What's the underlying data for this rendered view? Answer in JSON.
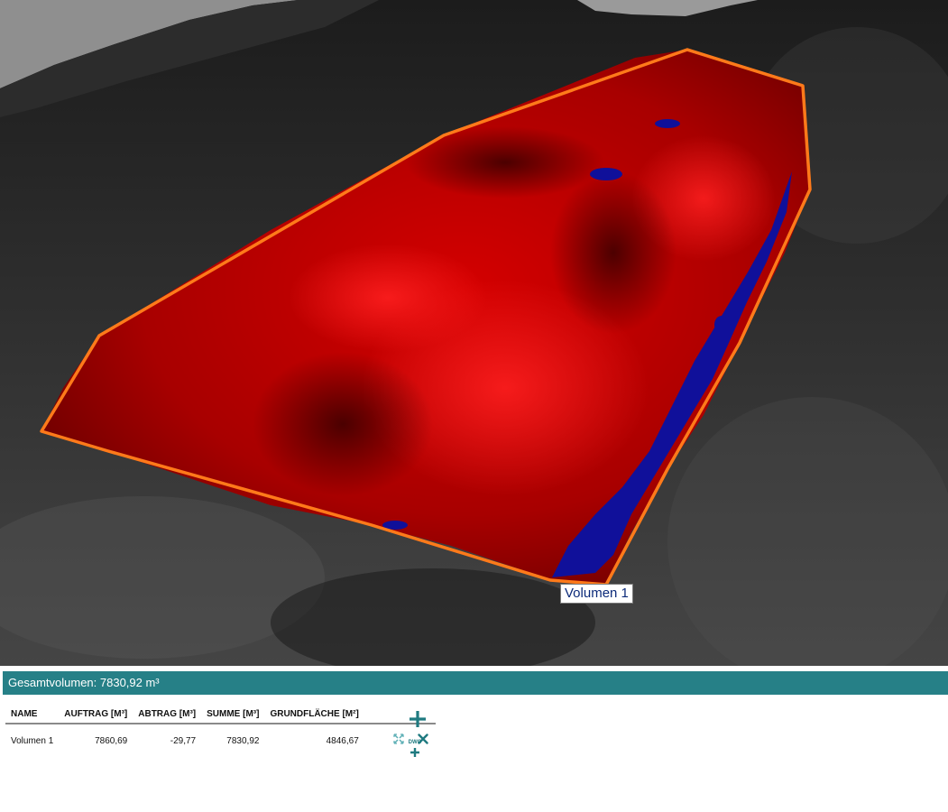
{
  "viewport": {
    "volume_label": "Volumen 1",
    "colors": {
      "boundary": "#ff7a1a",
      "fill_area": "#cc0000",
      "cut_area": "#10109a",
      "terrain": "#3a3a3a",
      "sky": "#9a9a9a"
    }
  },
  "panel": {
    "total_volume": "Gesamtvolumen: 7830,92 m³",
    "accent_color": "#268087",
    "columns": [
      "NAME",
      "AUFTRAG [M³]",
      "ABTRAG [M³]",
      "SUMME [M³]",
      "GRUNDFLÄCHE [M²]"
    ],
    "rows": [
      {
        "name": "Volumen 1",
        "auftrag": "7860,69",
        "abtrag": "-29,77",
        "summe": "7830,92",
        "grundflaeche": "4846,67"
      }
    ],
    "actions": {
      "zoom_icon": "zoom-extent-icon",
      "delete_icon": "close-icon",
      "add_icon": "plus-icon",
      "dwg_icon": "dwg-import-icon",
      "dwg_label": "DWG"
    }
  }
}
